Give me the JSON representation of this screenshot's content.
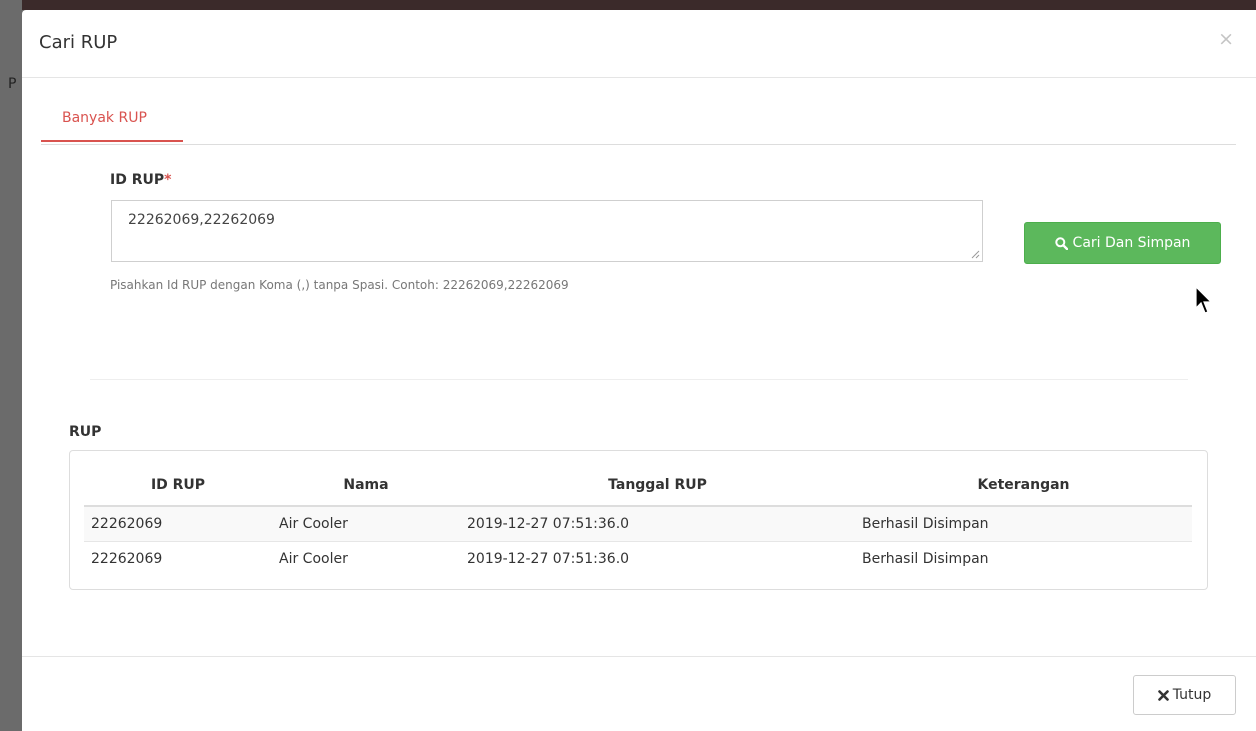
{
  "backdrop": {
    "peek_char": "P"
  },
  "modal": {
    "title": "Cari RUP",
    "close_glyph": "×",
    "tab_label": "Banyak RUP",
    "field": {
      "label": "ID RUP",
      "required_mark": "*",
      "value": "22262069,22262069",
      "help": "Pisahkan Id RUP dengan Koma (,) tanpa Spasi. Contoh: 22262069,22262069"
    },
    "search_button_label": "Cari Dan Simpan",
    "section_label": "RUP",
    "table": {
      "headers": [
        "ID RUP",
        "Nama",
        "Tanggal RUP",
        "Keterangan"
      ],
      "rows": [
        [
          "22262069",
          "Air Cooler",
          "2019-12-27 07:51:36.0",
          "Berhasil Disimpan"
        ],
        [
          "22262069",
          "Air Cooler",
          "2019-12-27 07:51:36.0",
          "Berhasil Disimpan"
        ]
      ]
    },
    "close_button_label": "Tutup"
  },
  "colors": {
    "accent": "#d9534f",
    "success": "#5cb85c"
  }
}
